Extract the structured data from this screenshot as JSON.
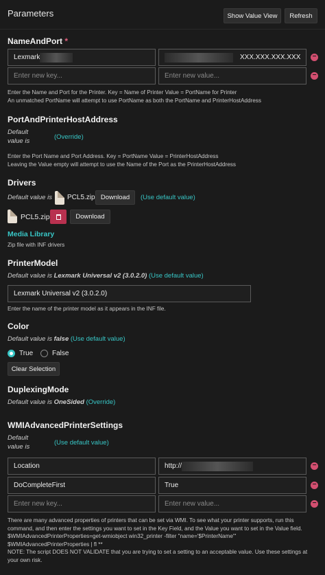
{
  "header": {
    "title": "Parameters",
    "show_value_view": "Show Value View",
    "refresh": "Refresh"
  },
  "name_and_port": {
    "heading": "NameAndPort",
    "required": "*",
    "key_value": "Lexmark",
    "value_value": "XXX.XXX.XXX.XXX",
    "key_placeholder": "Enter new key...",
    "value_placeholder": "Enter new value...",
    "help_line1": "Enter the Name and Port for the Printer. Key = Name of Printer Value = PortName for Printer",
    "help_line2": "An unmatched PortName will attempt to use PortName as both the PortName and PrinterHostAddress"
  },
  "port_and_printer_host_address": {
    "heading": "PortAndPrinterHostAddress",
    "default_line1": "Default",
    "default_line2": "value is",
    "override": "(Override)",
    "help_line1": "Enter the Port Name and Port Address. Key = PortName Value = PrinterHostAddress",
    "help_line2": "Leaving the Value empty will attempt to use the Name of the Port as the PrinterHostAddress"
  },
  "drivers": {
    "heading": "Drivers",
    "default_label": "Default value is",
    "default_file": "PCL5.zip",
    "download": "Download",
    "use_default": "(Use default value)",
    "file": "PCL5.zip",
    "download2": "Download",
    "media_library": "Media Library",
    "help": "Zip file with INF drivers"
  },
  "printer_model": {
    "heading": "PrinterModel",
    "default_label": "Default value is",
    "default_value": "Lexmark Universal v2 (3.0.2.0)",
    "use_default": "(Use default value)",
    "value": "Lexmark Universal v2 (3.0.2.0)",
    "help": "Enter the name of the printer model as it appears in the INF file."
  },
  "color": {
    "heading": "Color",
    "default_label": "Default value is",
    "default_value": "false",
    "use_default": "(Use default value)",
    "option_true": "True",
    "option_false": "False",
    "clear": "Clear Selection"
  },
  "duplexing_mode": {
    "heading": "DuplexingMode",
    "default_label": "Default value is",
    "default_value": "OneSided",
    "override": "(Override)"
  },
  "wmi": {
    "heading": "WMIAdvancedPrinterSettings",
    "default_line1": "Default",
    "default_line2": "value is",
    "use_default": "(Use default value)",
    "rows": [
      {
        "key": "Location",
        "value": "http://"
      },
      {
        "key": "DoCompleteFirst",
        "value": "True"
      }
    ],
    "key_placeholder": "Enter new key...",
    "value_placeholder": "Enter new value...",
    "help_line1": "There are many advanced properties of printers that can be set via WMI. To see what your printer supports, run this",
    "help_line2": "command, and then enter the settings you want to set in the Key Field, and the Value you want to set in the Value field.",
    "help_line3": "$WMIAdvancedPrinterProperties=get-wmiobject win32_printer -filter \"name='$PrinterName'\"",
    "help_line4": "$WMIAdvancedPrinterProperties | fl **",
    "help_line5": "NOTE: The script DOES NOT VALIDATE that you are trying to set a setting to an acceptable value. Use these settings at",
    "help_line6": "your own risk."
  }
}
